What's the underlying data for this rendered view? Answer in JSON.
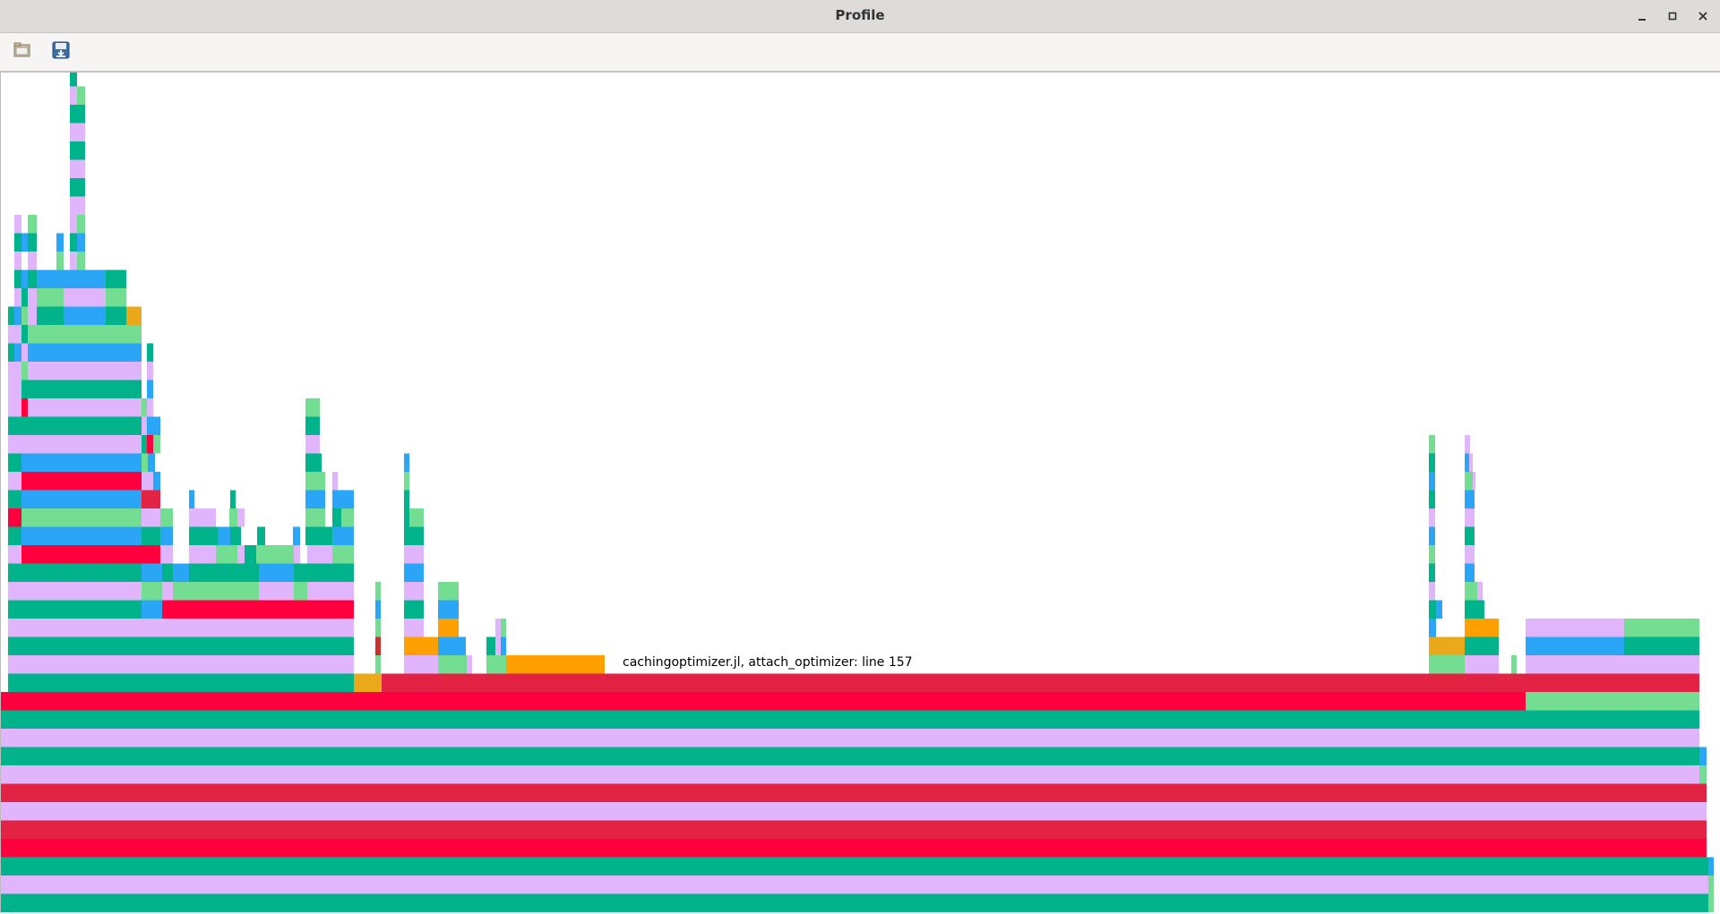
{
  "window": {
    "title": "Profile"
  },
  "window_controls": {
    "minimize_icon": "minimize-icon",
    "maximize_icon": "maximize-icon",
    "close_icon": "close-icon"
  },
  "toolbar": {
    "open_icon": "open-file-icon",
    "save_icon": "save-icon"
  },
  "colors": {
    "teal": "#00b38a",
    "lavender": "#e0b5fb",
    "blue": "#2ba6f7",
    "green": "#73de92",
    "red": "#ff003f",
    "crimson": "#e22343",
    "dark_red": "#cd2e30",
    "orange": "#ffa000",
    "gold": "#e9a91b"
  },
  "hover_tooltip": "cachingoptimizer.jl, attach_optimizer: line 157"
}
